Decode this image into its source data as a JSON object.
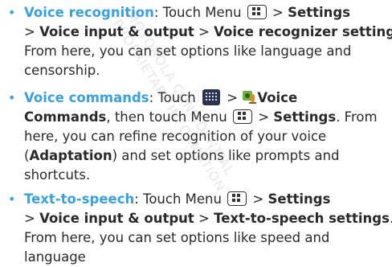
{
  "watermark": [
    "MOTOROLA CONFIDENTIAL",
    "PROPRIETARY INFORMATION"
  ],
  "items": [
    {
      "title": "Voice recognition",
      "l1": {
        "a": ": Touch Menu ",
        "b": " > ",
        "c": "Settings"
      },
      "l2": {
        "a": "> ",
        "b": "Voice input & output",
        "c": " > ",
        "d": "Voice recognizer settings",
        "e": "."
      },
      "l3": "From here, you can set options like language and",
      "l4": "censorship."
    },
    {
      "title": "Voice commands",
      "l1": {
        "a": ": Touch ",
        "b": " > ",
        "c": "Voice"
      },
      "l2": {
        "a": "Commands",
        "b": ", then touch Menu ",
        "c": " > ",
        "d": "Settings",
        "e": ". From"
      },
      "l3": "here, you can refine recognition of your voice",
      "l4": {
        "a": "(",
        "b": "Adaptation",
        "c": ") and set options like prompts and"
      },
      "l5": "shortcuts."
    },
    {
      "title": "Text-to-speech",
      "l1": {
        "a": ": Touch Menu ",
        "b": " > ",
        "c": "Settings"
      },
      "l2": {
        "a": "> ",
        "b": "Voice input & output",
        "c": " > ",
        "d": "Text-to-speech settings",
        "e": "."
      },
      "l3": "From here, you can set options like speed and",
      "l4": "language"
    }
  ],
  "icons": {
    "menu": "menu-key-icon",
    "apps": "apps-launcher-icon",
    "voice": "voice-commands-icon"
  },
  "colors": {
    "accent": "#3aa0e0",
    "text": "#2a2a2a"
  }
}
